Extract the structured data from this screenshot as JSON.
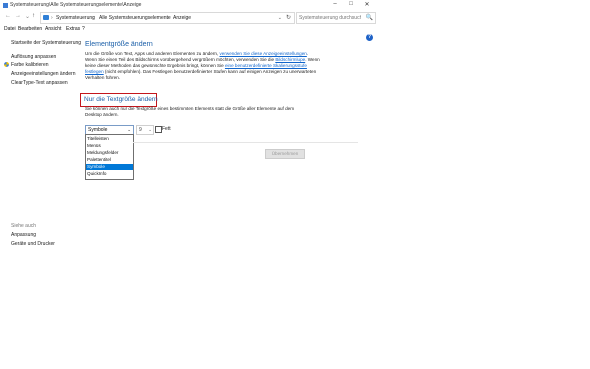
{
  "window": {
    "title": "Systemsteuerung\\Alle Systemsteuerungselemente\\Anzeige",
    "controls": {
      "minimize": "–",
      "maximize": "□",
      "close": "✕"
    }
  },
  "nav": {
    "back": "←",
    "forward": "→",
    "dropdown": "⌄",
    "up": "↑"
  },
  "address": {
    "crumbs": [
      "Systemsteuerung",
      "Alle Systemsteuerungselemente",
      "Anzeige"
    ],
    "separator": "›",
    "dropdown": "⌄",
    "refresh": "↻"
  },
  "search": {
    "placeholder": "Systemsteuerung durchsuchen",
    "icon": "🔍"
  },
  "menu": [
    "Datei",
    "Bearbeiten",
    "Ansicht",
    "Extras",
    "?"
  ],
  "sidebar": {
    "items": [
      {
        "label": "Startseite der Systemsteuerung"
      },
      {
        "label": "Auflösung anpassen"
      },
      {
        "label": "Farbe kalibrieren"
      },
      {
        "label": "Anzeigeeinstellungen ändern"
      },
      {
        "label": "ClearType-Text anpassen"
      }
    ],
    "see_also": "Siehe auch",
    "see_also_items": [
      {
        "label": "Anpassung"
      },
      {
        "label": "Geräte und Drucker"
      }
    ]
  },
  "help": {
    "icon": "?"
  },
  "main": {
    "heading": "Elementgröße ändern",
    "para_part1": "Um die Größe von Text, Apps und anderen Elementen zu ändern, ",
    "para_link1": "verwenden Sie diese Anzeigeeinstellungen",
    "para_part2": ". Wenn Sie einen Teil des Bildschirms vorübergehend vergrößern möchten, verwenden Sie die ",
    "para_link2": "Bildschirmlupe",
    "para_part3": ". Wenn keine dieser Methoden das gewünschte Ergebnis bringt, können Sie ",
    "para_link3": "eine benutzerdefinierte Skalierungsstufe festlegen",
    "para_part4": " (nicht empfohlen). Das Festlegen benutzerdefinierter Stufen kann auf einigen Anzeigen zu unerwarteten Verhalten führen.",
    "subheading": "Nur die Textgröße ändern",
    "sub_para": "Sie können auch nur die Textgröße eines bestimmten Elements statt die Größe aller Elemente auf dem Desktop ändern.",
    "element_select": {
      "value": "Symbole",
      "arrow": "⌄",
      "options": [
        "Titelleisten",
        "Menüs",
        "Meldungsfelder",
        "Palettentitel",
        "Symbole",
        "QuickInfo"
      ],
      "selected_index": 4
    },
    "size_select": {
      "value": "9",
      "arrow": "⌄"
    },
    "bold_label": "Fett",
    "apply_button": "Übernehmen"
  }
}
